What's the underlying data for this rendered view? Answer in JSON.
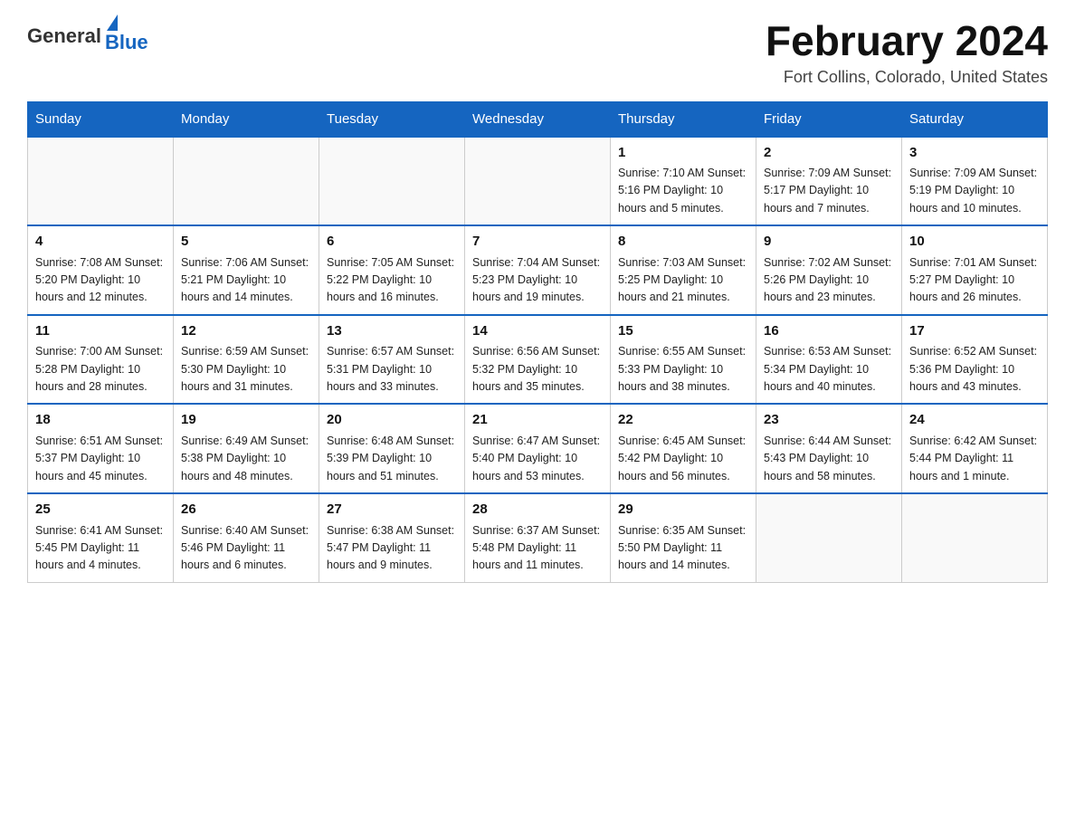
{
  "header": {
    "logo_general": "General",
    "logo_blue": "Blue",
    "month_title": "February 2024",
    "location": "Fort Collins, Colorado, United States"
  },
  "days_of_week": [
    "Sunday",
    "Monday",
    "Tuesday",
    "Wednesday",
    "Thursday",
    "Friday",
    "Saturday"
  ],
  "weeks": [
    [
      {
        "day": "",
        "info": ""
      },
      {
        "day": "",
        "info": ""
      },
      {
        "day": "",
        "info": ""
      },
      {
        "day": "",
        "info": ""
      },
      {
        "day": "1",
        "info": "Sunrise: 7:10 AM\nSunset: 5:16 PM\nDaylight: 10 hours and 5 minutes."
      },
      {
        "day": "2",
        "info": "Sunrise: 7:09 AM\nSunset: 5:17 PM\nDaylight: 10 hours and 7 minutes."
      },
      {
        "day": "3",
        "info": "Sunrise: 7:09 AM\nSunset: 5:19 PM\nDaylight: 10 hours and 10 minutes."
      }
    ],
    [
      {
        "day": "4",
        "info": "Sunrise: 7:08 AM\nSunset: 5:20 PM\nDaylight: 10 hours and 12 minutes."
      },
      {
        "day": "5",
        "info": "Sunrise: 7:06 AM\nSunset: 5:21 PM\nDaylight: 10 hours and 14 minutes."
      },
      {
        "day": "6",
        "info": "Sunrise: 7:05 AM\nSunset: 5:22 PM\nDaylight: 10 hours and 16 minutes."
      },
      {
        "day": "7",
        "info": "Sunrise: 7:04 AM\nSunset: 5:23 PM\nDaylight: 10 hours and 19 minutes."
      },
      {
        "day": "8",
        "info": "Sunrise: 7:03 AM\nSunset: 5:25 PM\nDaylight: 10 hours and 21 minutes."
      },
      {
        "day": "9",
        "info": "Sunrise: 7:02 AM\nSunset: 5:26 PM\nDaylight: 10 hours and 23 minutes."
      },
      {
        "day": "10",
        "info": "Sunrise: 7:01 AM\nSunset: 5:27 PM\nDaylight: 10 hours and 26 minutes."
      }
    ],
    [
      {
        "day": "11",
        "info": "Sunrise: 7:00 AM\nSunset: 5:28 PM\nDaylight: 10 hours and 28 minutes."
      },
      {
        "day": "12",
        "info": "Sunrise: 6:59 AM\nSunset: 5:30 PM\nDaylight: 10 hours and 31 minutes."
      },
      {
        "day": "13",
        "info": "Sunrise: 6:57 AM\nSunset: 5:31 PM\nDaylight: 10 hours and 33 minutes."
      },
      {
        "day": "14",
        "info": "Sunrise: 6:56 AM\nSunset: 5:32 PM\nDaylight: 10 hours and 35 minutes."
      },
      {
        "day": "15",
        "info": "Sunrise: 6:55 AM\nSunset: 5:33 PM\nDaylight: 10 hours and 38 minutes."
      },
      {
        "day": "16",
        "info": "Sunrise: 6:53 AM\nSunset: 5:34 PM\nDaylight: 10 hours and 40 minutes."
      },
      {
        "day": "17",
        "info": "Sunrise: 6:52 AM\nSunset: 5:36 PM\nDaylight: 10 hours and 43 minutes."
      }
    ],
    [
      {
        "day": "18",
        "info": "Sunrise: 6:51 AM\nSunset: 5:37 PM\nDaylight: 10 hours and 45 minutes."
      },
      {
        "day": "19",
        "info": "Sunrise: 6:49 AM\nSunset: 5:38 PM\nDaylight: 10 hours and 48 minutes."
      },
      {
        "day": "20",
        "info": "Sunrise: 6:48 AM\nSunset: 5:39 PM\nDaylight: 10 hours and 51 minutes."
      },
      {
        "day": "21",
        "info": "Sunrise: 6:47 AM\nSunset: 5:40 PM\nDaylight: 10 hours and 53 minutes."
      },
      {
        "day": "22",
        "info": "Sunrise: 6:45 AM\nSunset: 5:42 PM\nDaylight: 10 hours and 56 minutes."
      },
      {
        "day": "23",
        "info": "Sunrise: 6:44 AM\nSunset: 5:43 PM\nDaylight: 10 hours and 58 minutes."
      },
      {
        "day": "24",
        "info": "Sunrise: 6:42 AM\nSunset: 5:44 PM\nDaylight: 11 hours and 1 minute."
      }
    ],
    [
      {
        "day": "25",
        "info": "Sunrise: 6:41 AM\nSunset: 5:45 PM\nDaylight: 11 hours and 4 minutes."
      },
      {
        "day": "26",
        "info": "Sunrise: 6:40 AM\nSunset: 5:46 PM\nDaylight: 11 hours and 6 minutes."
      },
      {
        "day": "27",
        "info": "Sunrise: 6:38 AM\nSunset: 5:47 PM\nDaylight: 11 hours and 9 minutes."
      },
      {
        "day": "28",
        "info": "Sunrise: 6:37 AM\nSunset: 5:48 PM\nDaylight: 11 hours and 11 minutes."
      },
      {
        "day": "29",
        "info": "Sunrise: 6:35 AM\nSunset: 5:50 PM\nDaylight: 11 hours and 14 minutes."
      },
      {
        "day": "",
        "info": ""
      },
      {
        "day": "",
        "info": ""
      }
    ]
  ]
}
